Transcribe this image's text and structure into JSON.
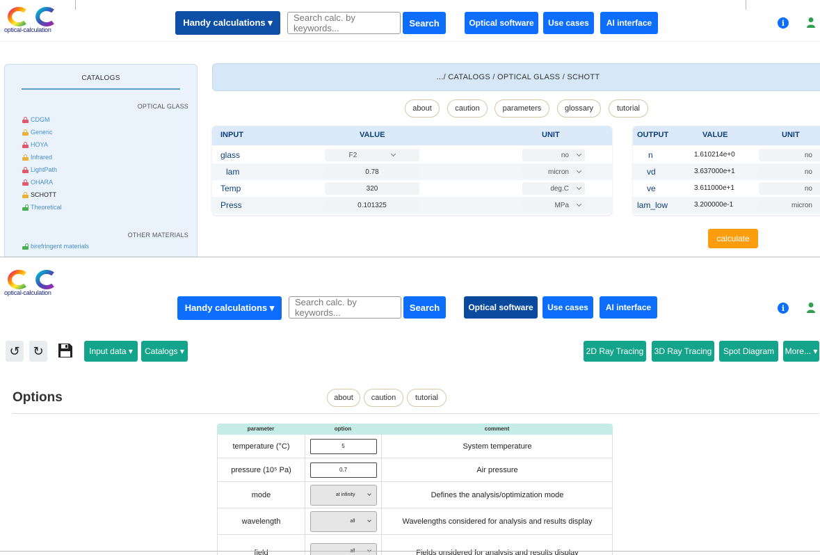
{
  "brand": {
    "logo_text": "optical-calculation"
  },
  "header": {
    "handy_label": "Handy calculations ▾",
    "search_placeholder": "Search calc. by keywords...",
    "search_label": "Search",
    "optical_software": "Optical software",
    "use_cases": "Use cases",
    "ai_interface": "AI interface",
    "info_glyph": "i"
  },
  "catalogs": {
    "title": "CATALOGS",
    "group_optical": "OPTICAL GLASS",
    "items": [
      "CDGM",
      "Generic",
      "HOYA",
      "Infrared",
      "LightPath",
      "OHARA",
      "SCHOTT",
      "Theoretical"
    ],
    "group_other": "OTHER MATERIALS",
    "other_items": [
      "birefringent materials"
    ]
  },
  "breadcrumb": ".../ CATALOGS / OPTICAL GLASS / SCHOTT",
  "tabs1": [
    "about",
    "caution",
    "parameters",
    "glossary",
    "tutorial"
  ],
  "input_table": {
    "headers": [
      "INPUT",
      "VALUE",
      "UNIT"
    ],
    "rows": [
      {
        "name": "glass",
        "value": "F2",
        "unit": "no"
      },
      {
        "name": "lam",
        "value": "0.78",
        "unit": "micron"
      },
      {
        "name": "Temp",
        "value": "320",
        "unit": "deg.C"
      },
      {
        "name": "Press",
        "value": "0.101325",
        "unit": "MPa"
      }
    ]
  },
  "output_table": {
    "headers": [
      "OUTPUT",
      "VALUE",
      "UNIT"
    ],
    "rows": [
      {
        "name": "n",
        "value": "1.610214e+0",
        "unit": "no"
      },
      {
        "name": "vd",
        "value": "3.637000e+1",
        "unit": "no"
      },
      {
        "name": "ve",
        "value": "3.611000e+1",
        "unit": "no"
      },
      {
        "name": "lam_low",
        "value": "3.200000e-1",
        "unit": "micron"
      }
    ]
  },
  "calculate_label": "calculate",
  "toolbar2": {
    "undo": "↺",
    "redo": "↻",
    "input_data": "Input data ▾",
    "catalogs": "Catalogs ▾",
    "ray2d": "2D Ray Tracing",
    "ray3d": "3D Ray Tracing",
    "spot": "Spot Diagram",
    "more": "More... ▾"
  },
  "options": {
    "title": "Options",
    "tabs": [
      "about",
      "caution",
      "tutorial"
    ],
    "headers": [
      "parameter",
      "option",
      "comment"
    ],
    "rows": [
      {
        "param": "temperature (°C)",
        "value": "5",
        "comment": "System temperature"
      },
      {
        "param": "pressure (10⁵ Pa)",
        "value": "0.7",
        "comment": "Air pressure"
      },
      {
        "param": "mode",
        "value": "at infinity",
        "comment": "Defines the analysis/optimization mode"
      },
      {
        "param": "wavelength",
        "value": "all",
        "comment": "Wavelengths considered for analysis and results display"
      },
      {
        "param": "field",
        "value": "all",
        "comment": "Fields onsidered for analysis and results display"
      }
    ]
  }
}
